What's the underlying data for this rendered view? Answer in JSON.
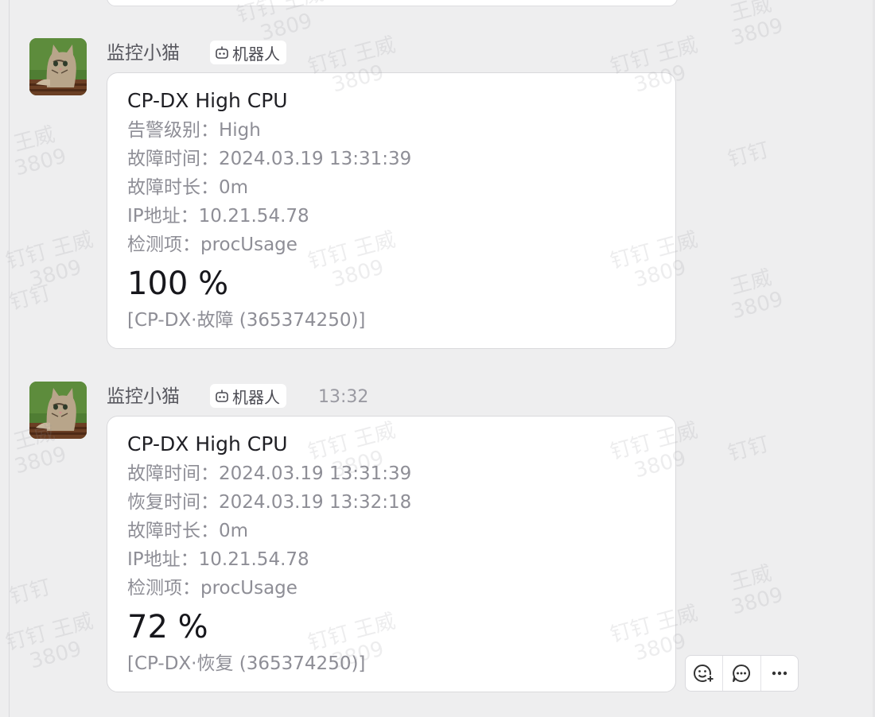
{
  "watermark": [
    "钉钉 王威\n3809",
    "钉钉",
    "王威\n3809"
  ],
  "colors": {
    "background": "#eeeeef",
    "card": "#ffffff",
    "title_text": "#1f1f24",
    "field_text": "#8e8e96"
  },
  "messages": [
    {
      "sender": "监控小猫",
      "badge": "机器人",
      "badge_icon": "robot-icon",
      "time": "",
      "card": {
        "title": "CP-DX High CPU",
        "fields": [
          {
            "label": "告警级别：",
            "value": "High"
          },
          {
            "label": "故障时间：",
            "value": "2024.03.19 13:31:39"
          },
          {
            "label": "故障时长：",
            "value": "0m"
          },
          {
            "label": "IP地址：",
            "value": "10.21.54.78"
          },
          {
            "label": "检测项：",
            "value": "procUsage"
          }
        ],
        "value": "100 %",
        "footer": "[CP-DX·故障 (365374250)]"
      }
    },
    {
      "sender": "监控小猫",
      "badge": "机器人",
      "badge_icon": "robot-icon",
      "time": "13:32",
      "card": {
        "title": "CP-DX High CPU",
        "fields": [
          {
            "label": "故障时间：",
            "value": "2024.03.19 13:31:39"
          },
          {
            "label": "恢复时间：",
            "value": "2024.03.19 13:32:18"
          },
          {
            "label": "故障时长：",
            "value": "0m"
          },
          {
            "label": "IP地址：",
            "value": "10.21.54.78"
          },
          {
            "label": "检测项：",
            "value": "procUsage"
          }
        ],
        "value": "72 %",
        "footer": "[CP-DX·恢复 (365374250)]"
      }
    }
  ],
  "actions": [
    {
      "name": "add-emoji-button",
      "icon": "emoji-add-icon"
    },
    {
      "name": "reply-button",
      "icon": "comment-icon"
    },
    {
      "name": "more-button",
      "icon": "more-horizontal-icon"
    }
  ]
}
